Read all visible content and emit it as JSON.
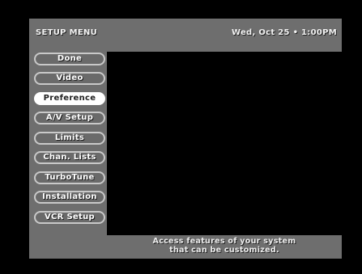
{
  "header": {
    "title": "SETUP MENU",
    "datetime": "Wed, Oct 25 • 1:00PM"
  },
  "menu": {
    "selected": "Preference",
    "items": [
      {
        "label": "Done"
      },
      {
        "label": "Video"
      },
      {
        "label": "Preference"
      },
      {
        "label": "A/V Setup"
      },
      {
        "label": "Limits"
      },
      {
        "label": "Chan. Lists"
      },
      {
        "label": "TurboTune"
      },
      {
        "label": "Installation"
      },
      {
        "label": "VCR Setup"
      }
    ]
  },
  "footer": {
    "line1": "Access features of your system",
    "line2": "that can be customized."
  },
  "colors": {
    "background": "#000000",
    "panel": "#6e6e6e",
    "button_border": "#c9c9c9",
    "selected_fill": "#ffffff"
  }
}
